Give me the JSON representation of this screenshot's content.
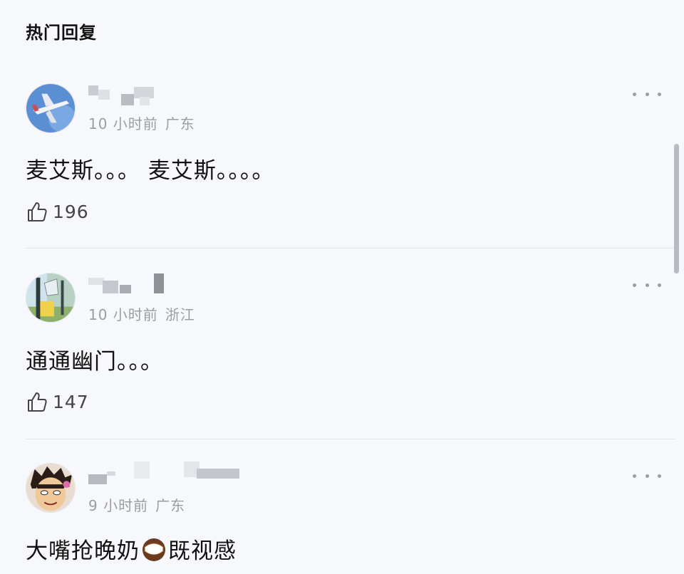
{
  "header": {
    "title": "热门回复"
  },
  "comments": [
    {
      "time": "10 小时前",
      "location": "广东",
      "text": "麦艾斯。。。 麦艾斯。。。。",
      "likes": "196",
      "avatar_icon": "airplane-avatar-icon"
    },
    {
      "time": "10 小时前",
      "location": "浙江",
      "text": "通通幽门。。。",
      "likes": "147",
      "avatar_icon": "cartoon-avatar-icon"
    },
    {
      "time": "9 小时前",
      "location": "广东",
      "text_before": "大嘴抢晚奶",
      "emoji": "coconut",
      "text_after": "既视感",
      "avatar_icon": "anime-face-avatar-icon"
    }
  ],
  "colors": {
    "background": "#f7f8fb",
    "meta_text": "#9a9da3",
    "divider": "#e3e5ea"
  }
}
